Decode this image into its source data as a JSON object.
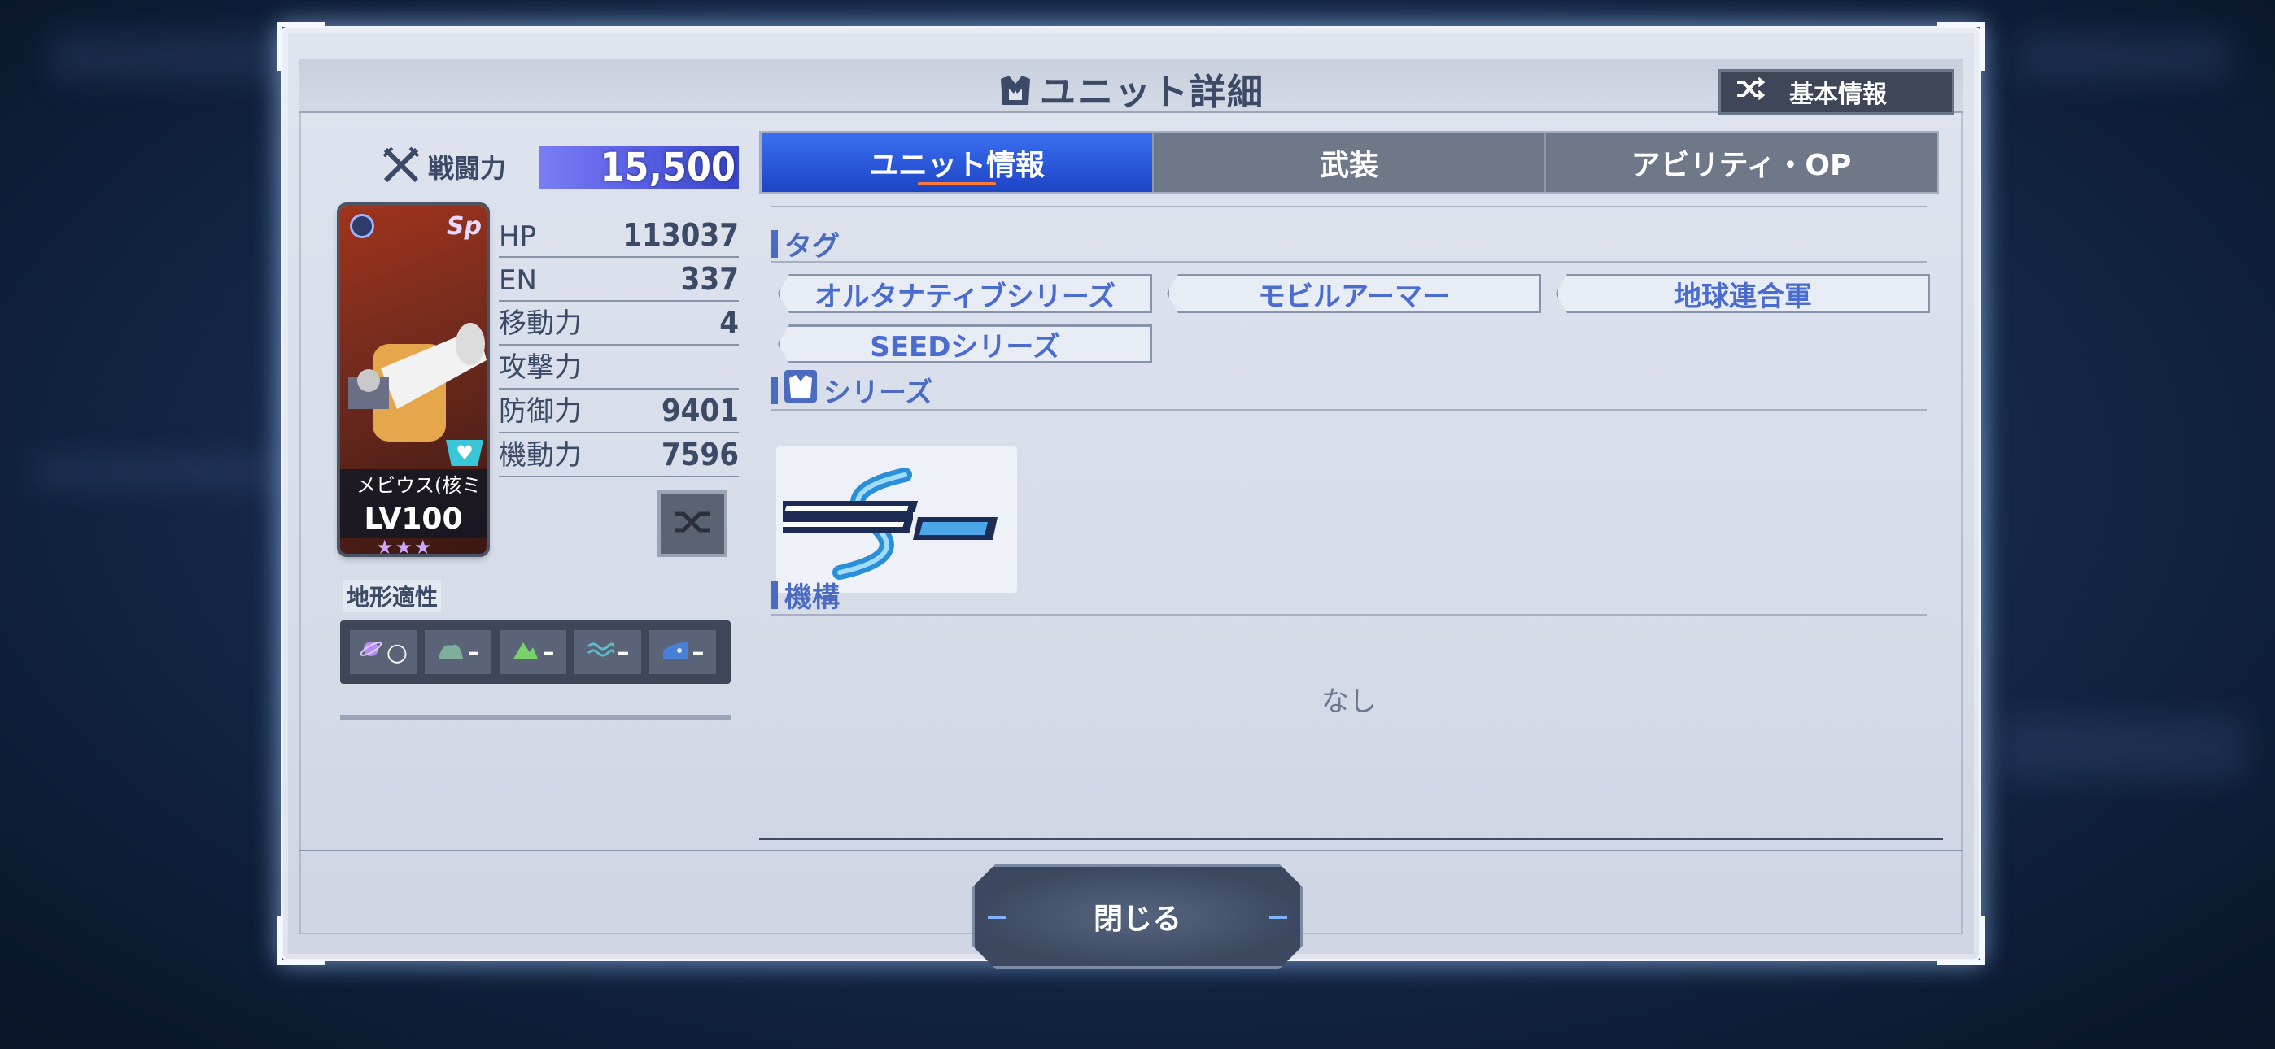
{
  "modal": {
    "title": "ユニット詳細",
    "basic_info_button": "基本情報",
    "close_button": "閉じる"
  },
  "unit": {
    "power_label": "戦闘力",
    "power_value": "15,500",
    "name": "メビウス(核ミ",
    "level": "LV100",
    "stars": "★★★",
    "sp_badge": "Sp",
    "stats": [
      {
        "label": "HP",
        "value": "113037"
      },
      {
        "label": "EN",
        "value": "337"
      },
      {
        "label": "移動力",
        "value": "4"
      },
      {
        "label": "攻撃力",
        "value": ""
      },
      {
        "label": "防御力",
        "value": "9401"
      },
      {
        "label": "機動力",
        "value": "7596"
      }
    ],
    "terrain_label": "地形適性",
    "terrain": [
      {
        "icon": "space-icon",
        "rating": "○"
      },
      {
        "icon": "air-icon",
        "rating": "–"
      },
      {
        "icon": "ground-icon",
        "rating": "–"
      },
      {
        "icon": "water-icon",
        "rating": "–"
      },
      {
        "icon": "underwater-icon",
        "rating": "–"
      }
    ]
  },
  "tabs": [
    {
      "label": "ユニット情報",
      "active": true
    },
    {
      "label": "武装",
      "active": false
    },
    {
      "label": "アビリティ・OP",
      "active": false
    }
  ],
  "sections": {
    "tags_title": "タグ",
    "tags": [
      "オルタナティブシリーズ",
      "モビルアーマー",
      "地球連合軍",
      "SEEDシリーズ"
    ],
    "series_title": "シリーズ",
    "series_logo_text": "SEED",
    "mechanism_title": "機構",
    "mechanism_value": "なし"
  },
  "colors": {
    "accent": "#1d44c5",
    "power_bar": "#5b61e8",
    "tag_text": "#4a6bd0"
  }
}
